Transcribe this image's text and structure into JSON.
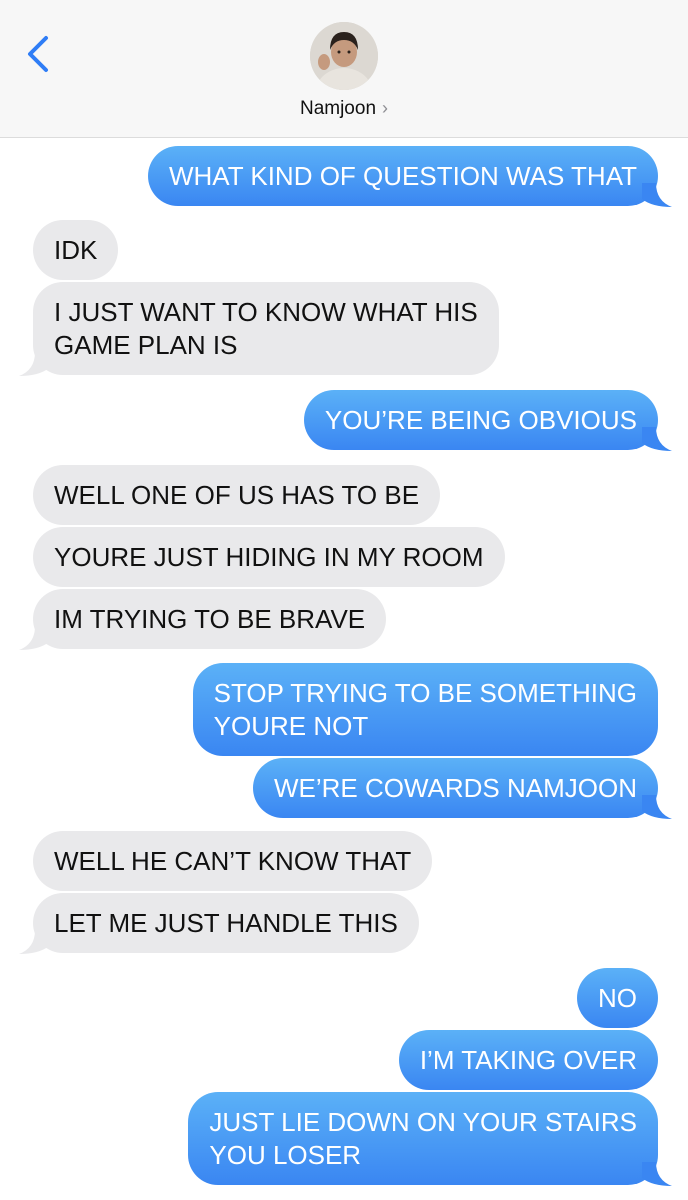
{
  "contact": {
    "name": "Namjoon",
    "chevron": "›"
  },
  "colors": {
    "sent": "#3a86f2",
    "received": "#e9e9eb",
    "back_accent": "#2f7df6"
  },
  "messages": [
    {
      "from": "me",
      "lines": [
        "WHAT KIND OF QUESTION WAS THAT"
      ]
    },
    {
      "from": "them",
      "lines": [
        "IDK"
      ]
    },
    {
      "from": "them",
      "lines": [
        "I JUST WANT TO KNOW WHAT HIS",
        "GAME PLAN IS"
      ]
    },
    {
      "from": "me",
      "lines": [
        "YOU’RE BEING OBVIOUS"
      ]
    },
    {
      "from": "them",
      "lines": [
        "WELL ONE OF US HAS TO BE"
      ]
    },
    {
      "from": "them",
      "lines": [
        "YOURE JUST HIDING IN MY ROOM"
      ]
    },
    {
      "from": "them",
      "lines": [
        "IM TRYING TO BE BRAVE"
      ]
    },
    {
      "from": "me",
      "lines": [
        "STOP TRYING TO BE SOMETHING",
        "YOURE NOT"
      ]
    },
    {
      "from": "me",
      "lines": [
        "WE’RE COWARDS NAMJOON"
      ]
    },
    {
      "from": "them",
      "lines": [
        "WELL HE CAN’T KNOW THAT"
      ]
    },
    {
      "from": "them",
      "lines": [
        "LET ME JUST HANDLE THIS"
      ]
    },
    {
      "from": "me",
      "lines": [
        "NO"
      ]
    },
    {
      "from": "me",
      "lines": [
        "I’M TAKING OVER"
      ]
    },
    {
      "from": "me",
      "lines": [
        "JUST LIE DOWN ON YOUR STAIRS",
        "YOU LOSER"
      ]
    }
  ]
}
